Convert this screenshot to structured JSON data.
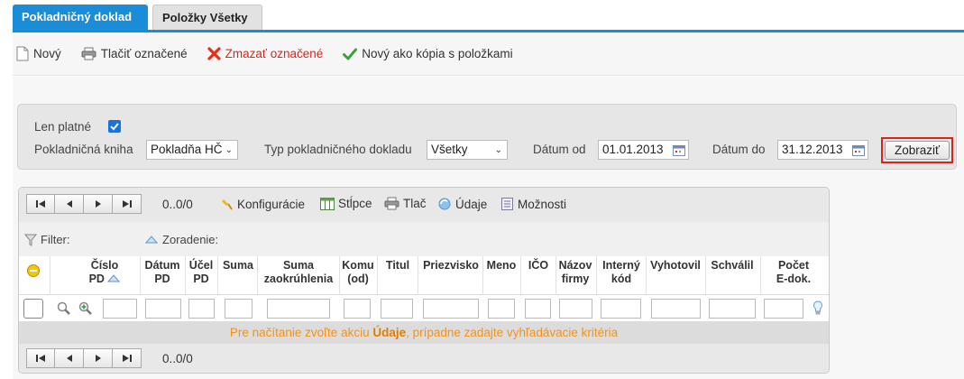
{
  "tabs": [
    {
      "label": "Pokladničný doklad",
      "active": true
    },
    {
      "label": "Položky Všetky",
      "active": false
    }
  ],
  "toolbar": {
    "new_label": "Nový",
    "print_label": "Tlačiť označené",
    "delete_label": "Zmazať označené",
    "copy_label": "Nový ako kópia s položkami"
  },
  "filter": {
    "only_valid_label": "Len platné",
    "only_valid_checked": true,
    "book_label": "Pokladničná kniha",
    "book_value": "Pokladňa HČ",
    "type_label": "Typ pokladničného dokladu",
    "type_value": "Všetky",
    "date_from_label": "Dátum od",
    "date_from_value": "01.01.2013",
    "date_to_label": "Dátum do",
    "date_to_value": "31.12.2013",
    "show_button": "Zobraziť"
  },
  "grid": {
    "pager_count": "0..0/0",
    "tools": {
      "config": "Konfigurácie",
      "columns": "Stĺpce",
      "print": "Tlač",
      "data": "Údaje",
      "options": "Možnosti"
    },
    "filter_label": "Filter:",
    "sort_label": "Zoradenie:",
    "headers": [
      {
        "l1": "Číslo",
        "l2": "PD"
      },
      {
        "l1": "Dátum",
        "l2": "PD"
      },
      {
        "l1": "Účel",
        "l2": "PD"
      },
      {
        "l1": "Suma",
        "l2": ""
      },
      {
        "l1": "Suma",
        "l2": "zaokrúhlenia"
      },
      {
        "l1": "Komu",
        "l2": "(od)"
      },
      {
        "l1": "Titul",
        "l2": ""
      },
      {
        "l1": "Priezvisko",
        "l2": ""
      },
      {
        "l1": "Meno",
        "l2": ""
      },
      {
        "l1": "IČO",
        "l2": ""
      },
      {
        "l1": "Názov",
        "l2": "firmy"
      },
      {
        "l1": "Interný",
        "l2": "kód"
      },
      {
        "l1": "Vyhotovil",
        "l2": ""
      },
      {
        "l1": "Schválil",
        "l2": ""
      },
      {
        "l1": "Počet",
        "l2": "E-dok."
      }
    ],
    "message_pre": "Pre načítanie zvoľte akciu ",
    "message_bold": "Údaje",
    "message_post": ", prípadne zadajte vyhľadávacie kritéria"
  }
}
